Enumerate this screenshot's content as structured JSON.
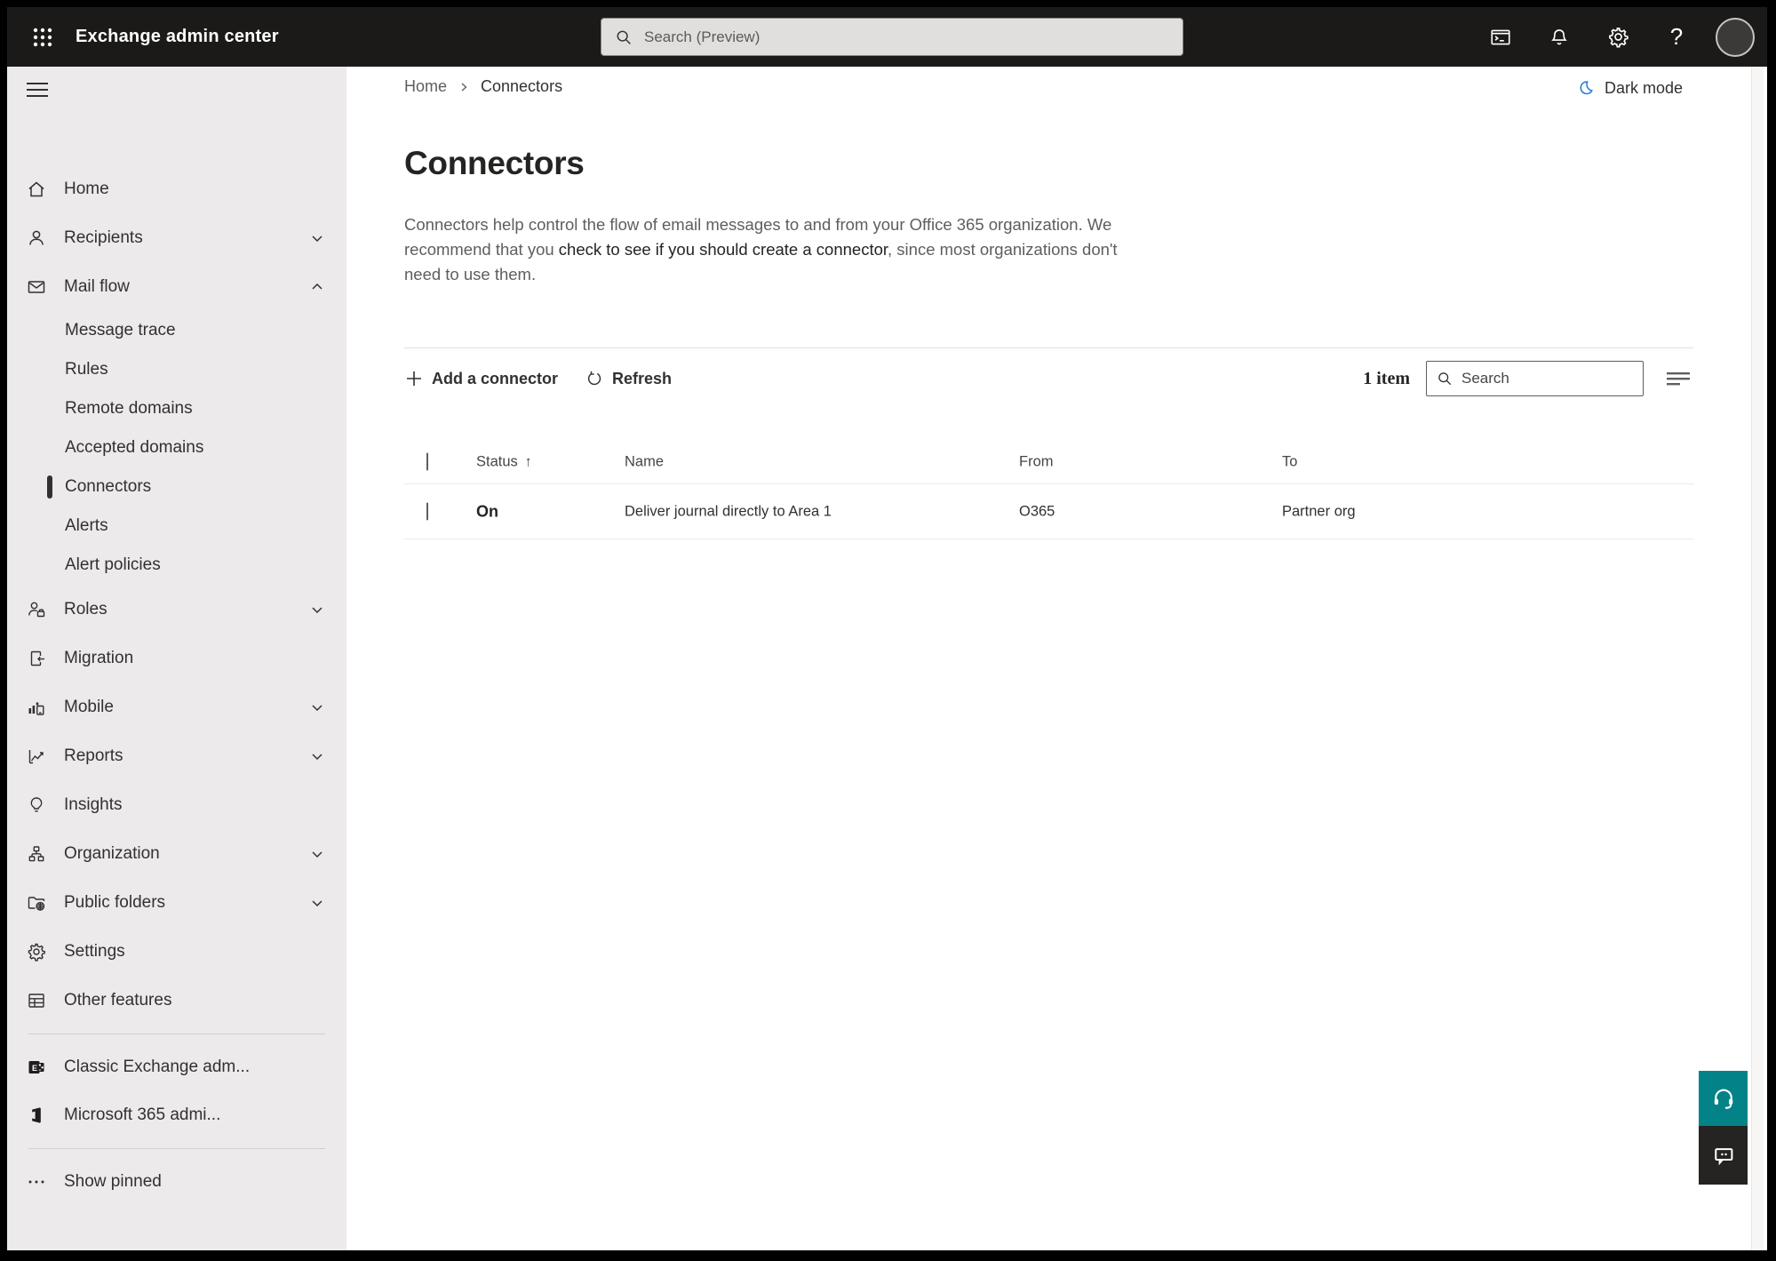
{
  "topbar": {
    "title": "Exchange admin center",
    "search_placeholder": "Search (Preview)"
  },
  "breadcrumb": {
    "home": "Home",
    "current": "Connectors"
  },
  "dark_mode_label": "Dark mode",
  "sidebar": {
    "items": [
      {
        "label": "Home"
      },
      {
        "label": "Recipients",
        "chevron": "down"
      },
      {
        "label": "Mail flow",
        "chevron": "up",
        "expanded": true
      },
      {
        "label": "Roles",
        "chevron": "down"
      },
      {
        "label": "Migration"
      },
      {
        "label": "Mobile",
        "chevron": "down"
      },
      {
        "label": "Reports",
        "chevron": "down"
      },
      {
        "label": "Insights"
      },
      {
        "label": "Organization",
        "chevron": "down"
      },
      {
        "label": "Public folders",
        "chevron": "down"
      },
      {
        "label": "Settings"
      },
      {
        "label": "Other features"
      }
    ],
    "mailflow_children": [
      "Message trace",
      "Rules",
      "Remote domains",
      "Accepted domains",
      "Connectors",
      "Alerts",
      "Alert policies"
    ],
    "selected_child": "Connectors",
    "footer": [
      {
        "label": "Classic Exchange adm..."
      },
      {
        "label": "Microsoft 365 admi..."
      }
    ],
    "show_pinned": "Show pinned"
  },
  "page": {
    "title": "Connectors",
    "description": {
      "part1": "Connectors help control the flow of email messages to and from your Office 365 organization. We\nrecommend that you ",
      "link": "check to see if you should create a connector",
      "part2": ", since most organizations don't\nneed to use them."
    }
  },
  "toolbar": {
    "add_label": "Add a connector",
    "refresh_label": "Refresh",
    "item_count": "1 item",
    "search_placeholder": "Search"
  },
  "table": {
    "columns": [
      "Status",
      "Name",
      "From",
      "To"
    ],
    "sorted_column": "Status",
    "sort_direction": "asc",
    "sort_glyph": "↑",
    "rows": [
      {
        "status": "On",
        "name": "Deliver journal directly to Area 1",
        "from": "O365",
        "to": "Partner org"
      }
    ]
  },
  "colors": {
    "topbar_bg": "#1b1a19",
    "sidebar_bg": "#eceaea",
    "accent_teal": "#038387",
    "moon_blue": "#2b7cd3",
    "selected_bar": "#323130"
  }
}
